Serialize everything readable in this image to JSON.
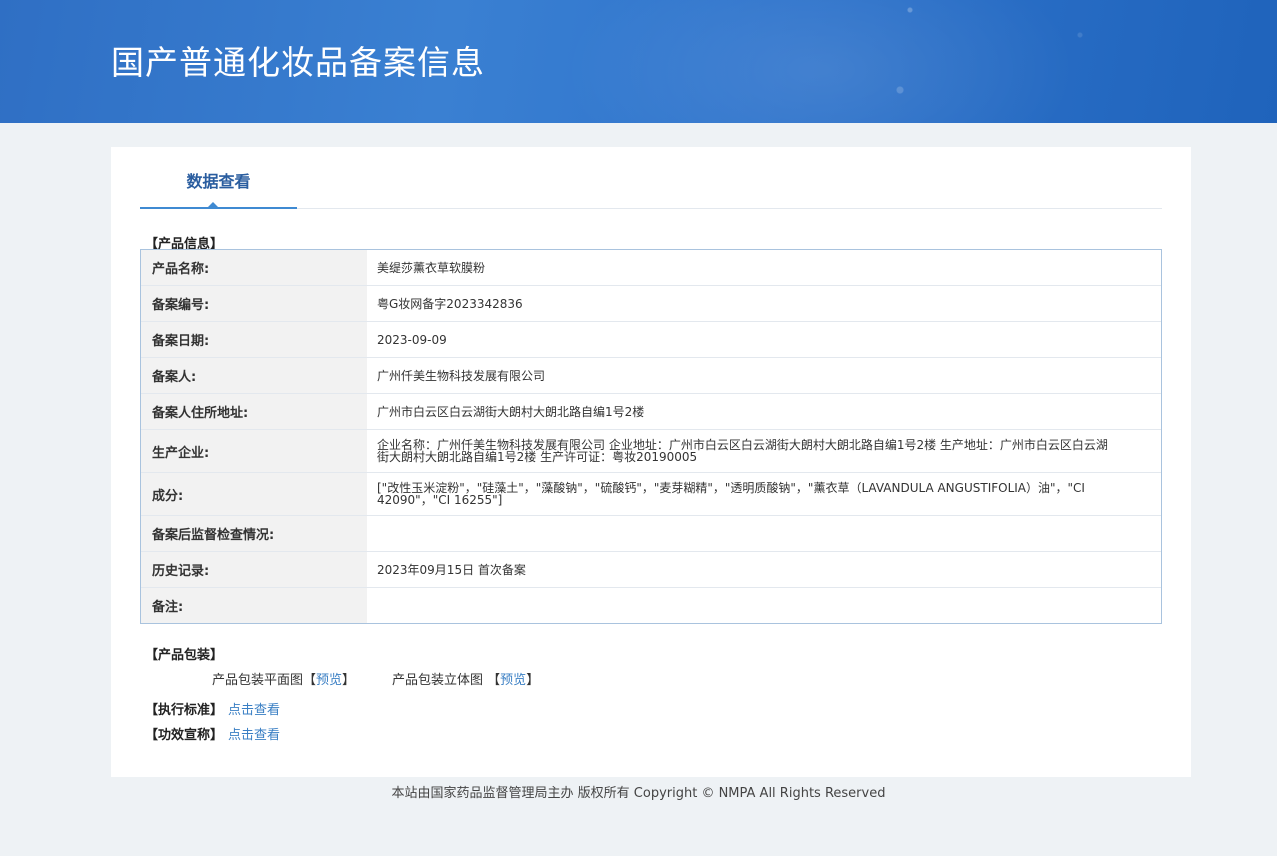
{
  "header": {
    "title": "国产普通化妆品备案信息"
  },
  "tabs": [
    {
      "label": "数据查看"
    }
  ],
  "product_info": {
    "section_title": "【产品信息】",
    "rows": [
      {
        "label": "产品名称:",
        "value": "美缇莎薰衣草软膜粉"
      },
      {
        "label": "备案编号:",
        "value": "粤G妆网备字2023342836"
      },
      {
        "label": "备案日期:",
        "value": "2023-09-09"
      },
      {
        "label": "备案人:",
        "value": "广州仟美生物科技发展有限公司"
      },
      {
        "label": "备案人住所地址:",
        "value": "广州市白云区白云湖街大朗村大朗北路自编1号2楼"
      },
      {
        "label": "生产企业:",
        "value": "企业名称：广州仟美生物科技发展有限公司 企业地址：广州市白云区白云湖街大朗村大朗北路自编1号2楼 生产地址：广州市白云区白云湖街大朗村大朗北路自编1号2楼 生产许可证：粤妆20190005"
      },
      {
        "label": "成分:",
        "value": "[\"改性玉米淀粉\"，\"硅藻土\"，\"藻酸钠\"，\"硫酸钙\"，\"麦芽糊精\"，\"透明质酸钠\"，\"薰衣草（LAVANDULA ANGUSTIFOLIA）油\"，\"CI 42090\"，\"CI 16255\"]"
      },
      {
        "label": "备案后监督检查情况:",
        "value": ""
      },
      {
        "label": "历史记录:",
        "value": "2023年09月15日 首次备案"
      },
      {
        "label": "备注:",
        "value": ""
      }
    ]
  },
  "packaging": {
    "section_title": "【产品包装】",
    "flat_label": "产品包装平面图",
    "stereo_label": "产品包装立体图",
    "preview_link": "预览",
    "bracket_open": "【",
    "bracket_close": "】"
  },
  "standard": {
    "label": "【执行标准】",
    "link": "点击查看"
  },
  "efficacy": {
    "label": "【功效宣称】",
    "link": "点击查看"
  },
  "footer": {
    "text": "本站由国家药品监督管理局主办 版权所有 Copyright © NMPA All Rights Reserved"
  }
}
